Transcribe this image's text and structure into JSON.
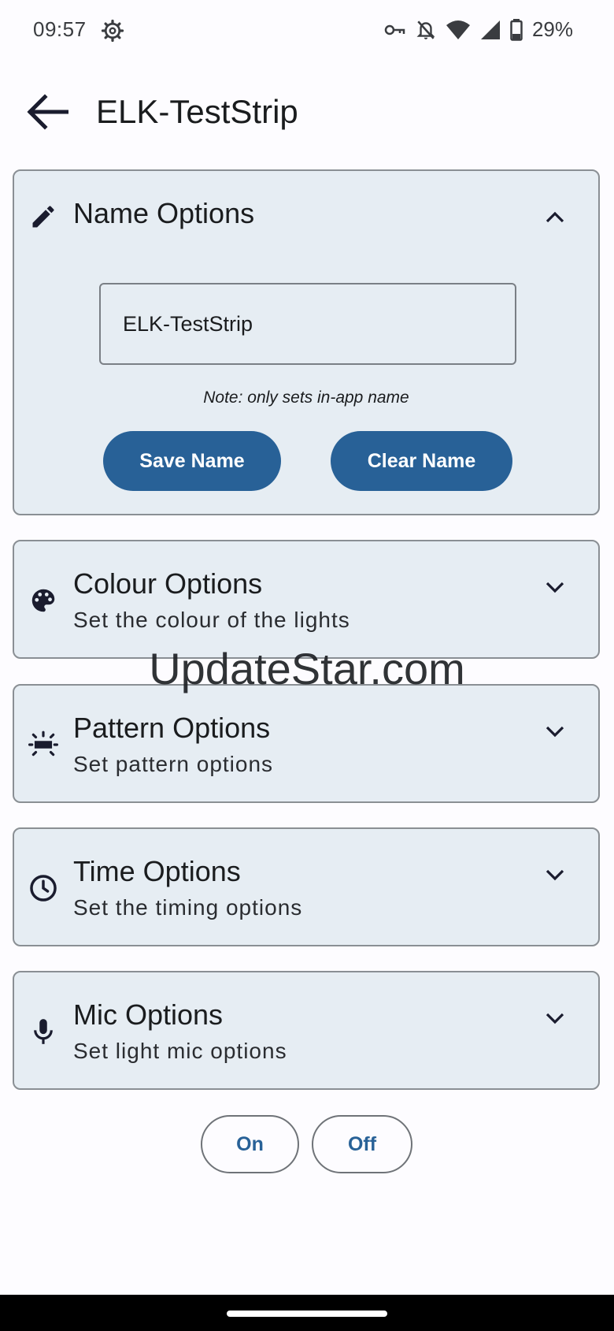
{
  "status_bar": {
    "time": "09:57",
    "battery": "29%",
    "icons": [
      "settings-icon",
      "vpn-key-icon",
      "notifications-off-icon",
      "wifi-icon",
      "signal-icon",
      "battery-icon"
    ]
  },
  "app_bar": {
    "title": "ELK-TestStrip",
    "back_icon": "arrow-back-icon"
  },
  "name_panel": {
    "title": "Name Options",
    "icon": "pencil-icon",
    "expanded": true,
    "name_value": "ELK-TestStrip",
    "note": "Note: only sets in-app name",
    "save_label": "Save Name",
    "clear_label": "Clear Name"
  },
  "panels": [
    {
      "title": "Colour Options",
      "subtitle": "Set the colour of the lights",
      "icon": "palette-icon"
    },
    {
      "title": "Pattern Options",
      "subtitle": "Set pattern options",
      "icon": "light-pattern-icon"
    },
    {
      "title": "Time Options",
      "subtitle": "Set the timing options",
      "icon": "clock-icon"
    },
    {
      "title": "Mic Options",
      "subtitle": "Set light mic options",
      "icon": "mic-icon"
    }
  ],
  "power": {
    "on_label": "On",
    "off_label": "Off"
  },
  "watermark": "UpdateStar.com",
  "colors": {
    "accent": "#286197",
    "panel_bg": "#e6edf3",
    "background": "#fdfcff"
  }
}
